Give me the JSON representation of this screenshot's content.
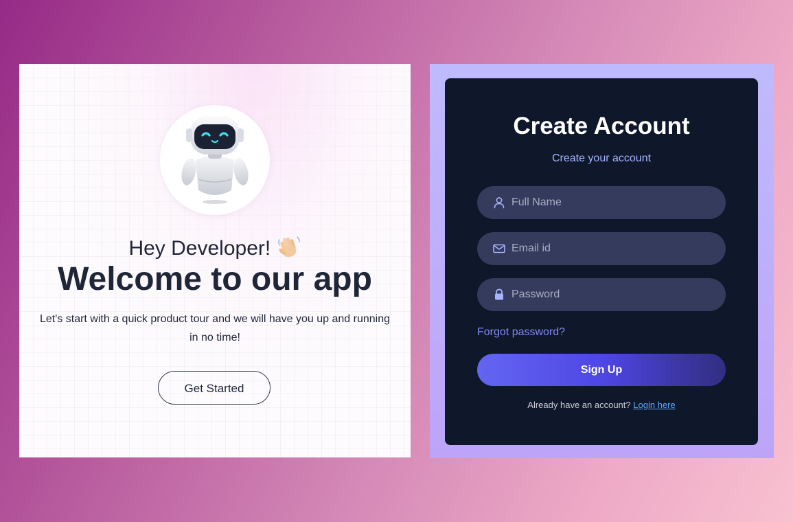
{
  "welcome": {
    "greeting": "Hey Developer!",
    "title": "Welcome to our app",
    "text": "Let's start with a quick product tour and we will have you up and running in no time!",
    "button_label": "Get Started"
  },
  "signup": {
    "title": "Create Account",
    "subtitle": "Create your account",
    "fields": [
      {
        "icon": "user-icon",
        "placeholder": "Full Name",
        "value": ""
      },
      {
        "icon": "mail-icon",
        "placeholder": "Email id",
        "value": ""
      },
      {
        "icon": "lock-icon",
        "placeholder": "Password",
        "value": ""
      }
    ],
    "forgot_password": "Forgot password?",
    "submit_label": "Sign Up",
    "login_prompt": "Already have an account?",
    "login_link": "Login here"
  },
  "colors": {
    "accent": "#6366f1",
    "card_dark": "#0f172a",
    "field_bg": "#353b5c",
    "link": "#818cf8",
    "login_link": "#60a5fa"
  }
}
